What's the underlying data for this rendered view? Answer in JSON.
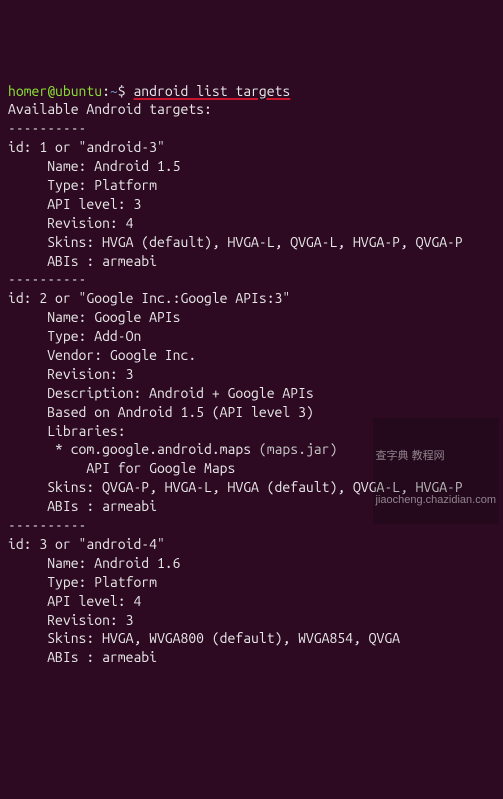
{
  "prompt": {
    "user_host": "homer@ubuntu",
    "sep1": ":",
    "path": "~",
    "sep2": "$ ",
    "command": "android list targets"
  },
  "header": "Available Android targets:",
  "dashline": "----------",
  "targets": [
    {
      "id_line": "id: 1 or \"android-3\"",
      "lines": [
        "     Name: Android 1.5",
        "     Type: Platform",
        "     API level: 3",
        "     Revision: 4",
        "     Skins: HVGA (default), HVGA-L, QVGA-L, HVGA-P, QVGA-P",
        "     ABIs : armeabi"
      ]
    },
    {
      "id_line": "id: 2 or \"Google Inc.:Google APIs:3\"",
      "lines": [
        "     Name: Google APIs",
        "     Type: Add-On",
        "     Vendor: Google Inc.",
        "     Revision: 3",
        "     Description: Android + Google APIs",
        "     Based on Android 1.5 (API level 3)",
        "     Libraries:"
      ],
      "lib_line_pre": "      * com.google.android.maps ",
      "lib_line_paren": "(maps.jar)",
      "lib_desc": "          API for Google Maps",
      "lines2": [
        "     Skins: QVGA-P, HVGA-L, HVGA (default), QVGA-L, HVGA-P",
        "     ABIs : armeabi"
      ]
    },
    {
      "id_line": "id: 3 or \"android-4\"",
      "lines": [
        "     Name: Android 1.6",
        "     Type: Platform",
        "     API level: 4",
        "     Revision: 3",
        "     Skins: HVGA, WVGA800 (default), WVGA854, QVGA",
        "     ABIs : armeabi"
      ]
    }
  ],
  "watermark": {
    "line1": "查字典 教程网",
    "line2": "jiaocheng.chazidian.com"
  }
}
